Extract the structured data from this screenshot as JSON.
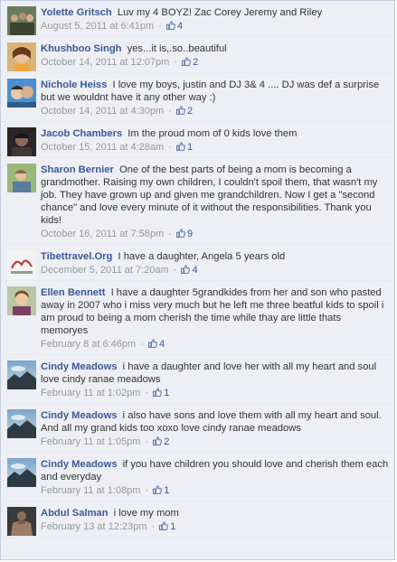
{
  "comments": [
    {
      "author": "Yolette Gritsch",
      "text": "Luv my 4 BOYZ! Zac Corey Jeremy and Riley",
      "time": "August 5, 2011 at 6:41pm",
      "likes": "4",
      "avatar": "avatar-yolette"
    },
    {
      "author": "Khushboo Singh",
      "text": "yes...it is,.so..beautiful",
      "time": "October 14, 2011 at 12:07pm",
      "likes": "2",
      "avatar": "avatar-khushboo"
    },
    {
      "author": "Nichole Heiss",
      "text": "I love my boys, justin and DJ 3& 4 .... DJ was def a surprise but we wouldnt have it any other way :)",
      "time": "October 14, 2011 at 4:30pm",
      "likes": "2",
      "avatar": "avatar-nichole"
    },
    {
      "author": "Jacob Chambers",
      "text": "Im the proud mom of 0 kids love them",
      "time": "October 15, 2011 at 4:28am",
      "likes": "1",
      "avatar": "avatar-jacob"
    },
    {
      "author": "Sharon Bernier",
      "text": "One of the best parts of being a mom is becoming a grandmother. Raising my own children, I couldn't spoil them, that wasn't my job. They have grown up and given me grandchildren. Now I get a \"second chance\" and love every minute of it without the responsibilities. Thank you kids!",
      "time": "October 16, 2011 at 7:58pm",
      "likes": "9",
      "avatar": "avatar-sharon"
    },
    {
      "author": "Tibettravel.Org",
      "text": "I have a daughter, Angela 5 years old",
      "time": "December 5, 2011 at 7:20am",
      "likes": "4",
      "avatar": "avatar-tibettravel"
    },
    {
      "author": "Ellen Bennett",
      "text": "I have a daughter 5grandkides from her and son who pasted away in 2007 who i miss very much but he left me three beatful kids to spoil i am proud to being a mom cherish the time while thay are little thats memoryes",
      "time": "February 8 at 6:46pm",
      "likes": "4",
      "avatar": "avatar-ellen"
    },
    {
      "author": "Cindy Meadows",
      "text": "i have a daughter and love her with all my heart and soul love cindy ranae meadows",
      "time": "February 11 at 1:02pm",
      "likes": "1",
      "avatar": "avatar-cindy"
    },
    {
      "author": "Cindy Meadows",
      "text": "i also have sons and love them with all my heart and soul. And all my grand kids too xoxo love cindy ranae meadows",
      "time": "February 11 at 1:05pm",
      "likes": "2",
      "avatar": "avatar-cindy"
    },
    {
      "author": "Cindy Meadows",
      "text": "if you have children you should love and cherish them each and everyday",
      "time": "February 11 at 1:08pm",
      "likes": "1",
      "avatar": "avatar-cindy"
    },
    {
      "author": "Abdul Salman",
      "text": "i love my mom",
      "time": "February 13 at 12:23pm",
      "likes": "1",
      "avatar": "avatar-abdul"
    }
  ],
  "meta_separator": "·",
  "colors": {
    "link": "#3b5998",
    "background": "#edeff4",
    "meta": "#999999"
  }
}
